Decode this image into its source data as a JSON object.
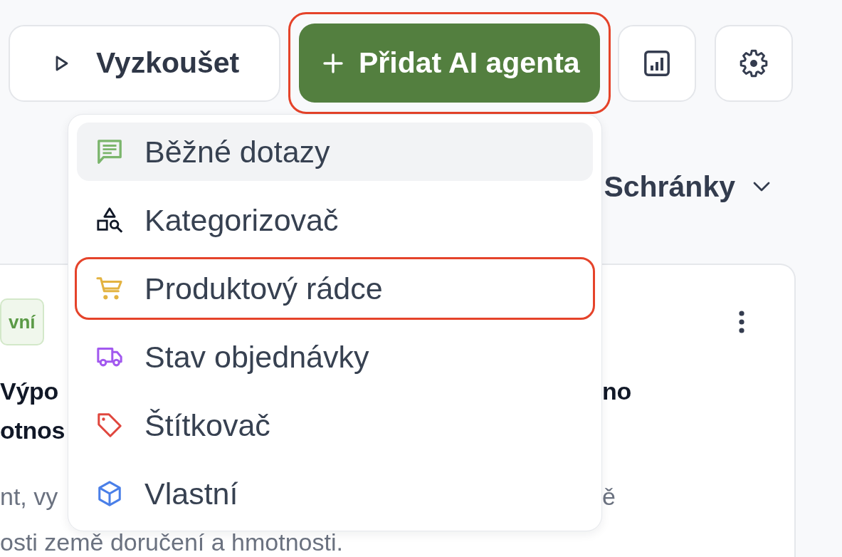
{
  "toolbar": {
    "try_button": {
      "label": "Vyzkoušet"
    },
    "add_agent_button": {
      "label": "Přidat AI agenta",
      "outlined": true
    },
    "icon_buttons": [
      {
        "kind": "stats"
      },
      {
        "kind": "settings"
      }
    ]
  },
  "agent_menu": {
    "items": [
      {
        "label": "Běžné dotazy",
        "kind": "faq",
        "selected": true,
        "outlined": false
      },
      {
        "label": "Kategorizovač",
        "kind": "categorizer",
        "selected": false,
        "outlined": false
      },
      {
        "label": "Produktový rádce",
        "kind": "product_advisor",
        "selected": false,
        "outlined": true
      },
      {
        "label": "Stav objednávky",
        "kind": "order_status",
        "selected": false,
        "outlined": false
      },
      {
        "label": "Štítkovač",
        "kind": "tagger",
        "selected": false,
        "outlined": false
      },
      {
        "label": "Vlastní",
        "kind": "custom",
        "selected": false,
        "outlined": false
      }
    ]
  },
  "filter": {
    "label": "Schránky"
  },
  "card": {
    "status_badge": "vní",
    "title_lines": [
      {
        "left_part": "Výpo",
        "right_part": "no"
      },
      {
        "left_part": "otnos"
      }
    ],
    "description_lines": [
      {
        "left_part": "nt, vy",
        "right_part": "ě"
      },
      {
        "left_part": "osti země doručení a hmotnosti."
      }
    ]
  }
}
